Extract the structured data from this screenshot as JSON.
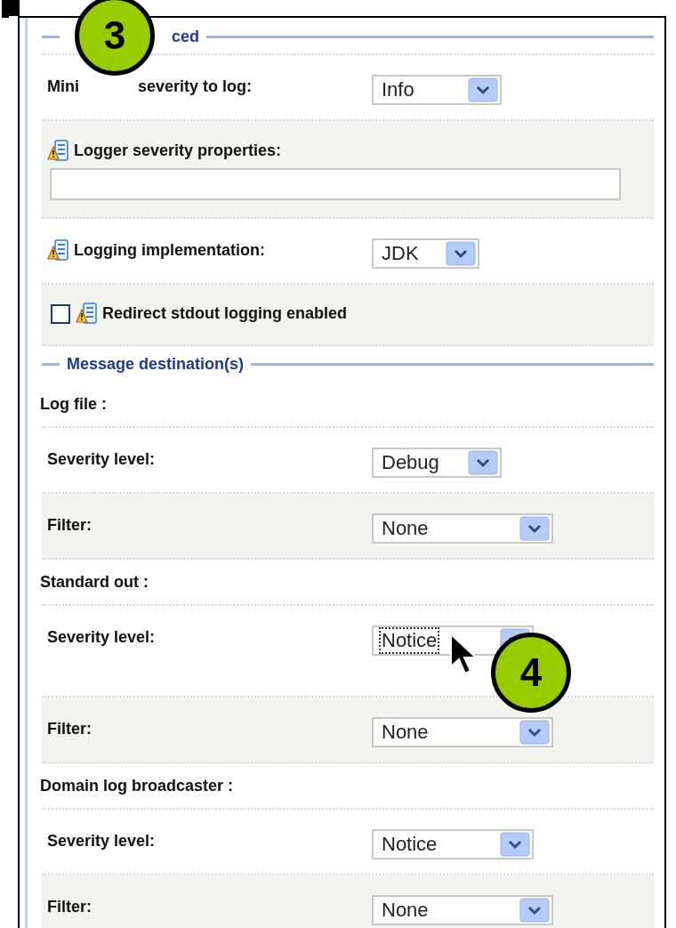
{
  "sections": [
    {
      "legend": "ced",
      "callout": "3",
      "rows": [
        {
          "kind": "select",
          "label_parts": [
            "Mini",
            "severity to log:"
          ],
          "value": "Info",
          "warning": false,
          "shaded": false,
          "focused": false
        },
        {
          "kind": "text",
          "label_parts": [
            "Logger severity properties:"
          ],
          "warning": true,
          "shaded": true
        },
        {
          "kind": "select",
          "label_parts": [
            "Logging implementation:"
          ],
          "value": "JDK",
          "warning": true,
          "shaded": false,
          "focused": false
        },
        {
          "kind": "checkbox",
          "label_parts": [
            "Redirect stdout logging enabled"
          ],
          "warning": true,
          "checked": false,
          "shaded": true
        }
      ]
    },
    {
      "legend": "Message destination(s)",
      "rows": [
        {
          "kind": "heading",
          "label_parts": [
            "Log file :"
          ]
        },
        {
          "kind": "select",
          "label_parts": [
            "Severity level:"
          ],
          "value": "Debug",
          "warning": false,
          "shaded": false,
          "focused": false
        },
        {
          "kind": "select",
          "label_parts": [
            "Filter:"
          ],
          "value": "None",
          "warning": false,
          "shaded": true,
          "focused": false
        },
        {
          "kind": "heading",
          "label_parts": [
            "Standard out :"
          ]
        },
        {
          "kind": "select",
          "label_parts": [
            "Severity level:"
          ],
          "value": "Notice",
          "warning": false,
          "shaded": false,
          "focused": true,
          "callout": "4"
        },
        {
          "kind": "select",
          "label_parts": [
            "Filter:"
          ],
          "value": "None",
          "warning": false,
          "shaded": true,
          "focused": false
        },
        {
          "kind": "heading",
          "label_parts": [
            "Domain log broadcaster :"
          ]
        },
        {
          "kind": "select",
          "label_parts": [
            "Severity level:"
          ],
          "value": "Notice",
          "warning": false,
          "shaded": false,
          "focused": false
        },
        {
          "kind": "select",
          "label_parts": [
            "Filter:"
          ],
          "value": "None",
          "warning": false,
          "shaded": true,
          "focused": false
        }
      ]
    }
  ]
}
